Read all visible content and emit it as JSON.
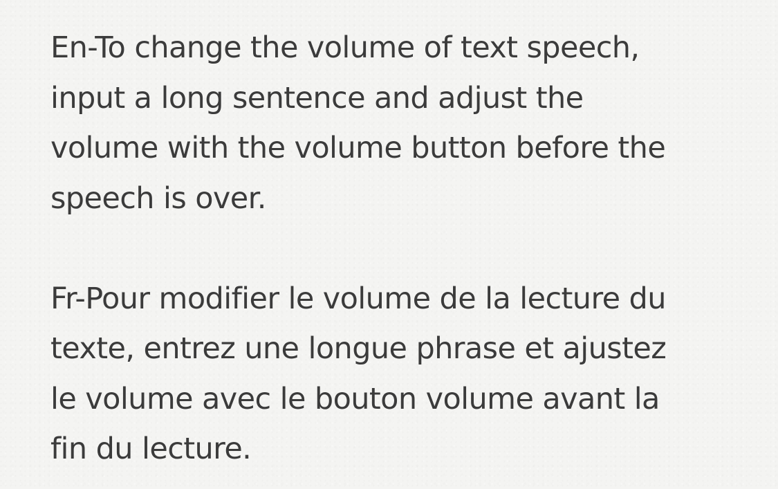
{
  "note": {
    "paragraphs": [
      "En-To change the volume of text speech,\ninput a long sentence and adjust the\nvolume with the volume button before the\nspeech is over.",
      "Fr-Pour modifier le volume de la lecture du\ntexte, entrez une longue phrase et ajustez\nle volume avec le bouton volume avant la\nfin du lecture."
    ]
  },
  "colors": {
    "background": "#f4f4f2",
    "text": "#3b3b3b"
  }
}
